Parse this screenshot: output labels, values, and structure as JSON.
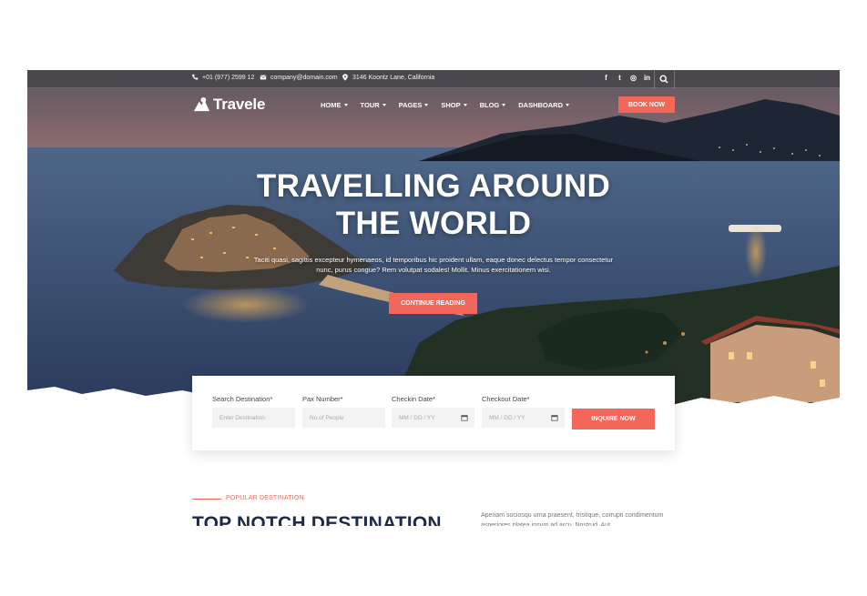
{
  "topbar": {
    "phone": "+01 (977) 2599 12",
    "email": "company@domain.com",
    "address": "3146 Koontz Lane, California",
    "social": [
      {
        "name": "facebook-icon",
        "glyph": "f"
      },
      {
        "name": "twitter-icon",
        "glyph": "t"
      },
      {
        "name": "instagram-icon",
        "glyph": "◎"
      },
      {
        "name": "linkedin-icon",
        "glyph": "in"
      }
    ]
  },
  "brand": {
    "name": "Travele"
  },
  "nav": {
    "items": [
      "HOME",
      "TOUR",
      "PAGES",
      "SHOP",
      "BLOG",
      "DASHBOARD"
    ],
    "book_now": "BOOK NOW"
  },
  "hero": {
    "title_line1": "TRAVELLING AROUND",
    "title_line2": "THE WORLD",
    "subtitle": "Taciti quasi, sagittis excepteur hymenaeos, id temporibus hic proident ullam, eaque donec delectus tempor consectetur nunc, purus congue? Rem volutpat sodales! Mollit. Minus exercitationem wisi.",
    "cta": "CONTINUE READING"
  },
  "search": {
    "fields": [
      {
        "label": "Search Destination*",
        "placeholder": "Enter Destination"
      },
      {
        "label": "Pax Number*",
        "placeholder": "No.of People"
      },
      {
        "label": "Checkin Date*",
        "placeholder": "MM / DD / YY"
      },
      {
        "label": "Checkout Date*",
        "placeholder": "MM / DD / YY"
      }
    ],
    "submit": "INQUIRE NOW"
  },
  "popular": {
    "eyebrow": "POPULAR DESTINATION",
    "title": "TOP NOTCH DESTINATION",
    "description": "Aperiam sociosqu urna praesent, tristique, corrupti condimentum asperiores platea ipsum ad arcu. Nostrud. Aut"
  },
  "colors": {
    "accent": "#f3675b",
    "heading": "#1d2a4a"
  }
}
